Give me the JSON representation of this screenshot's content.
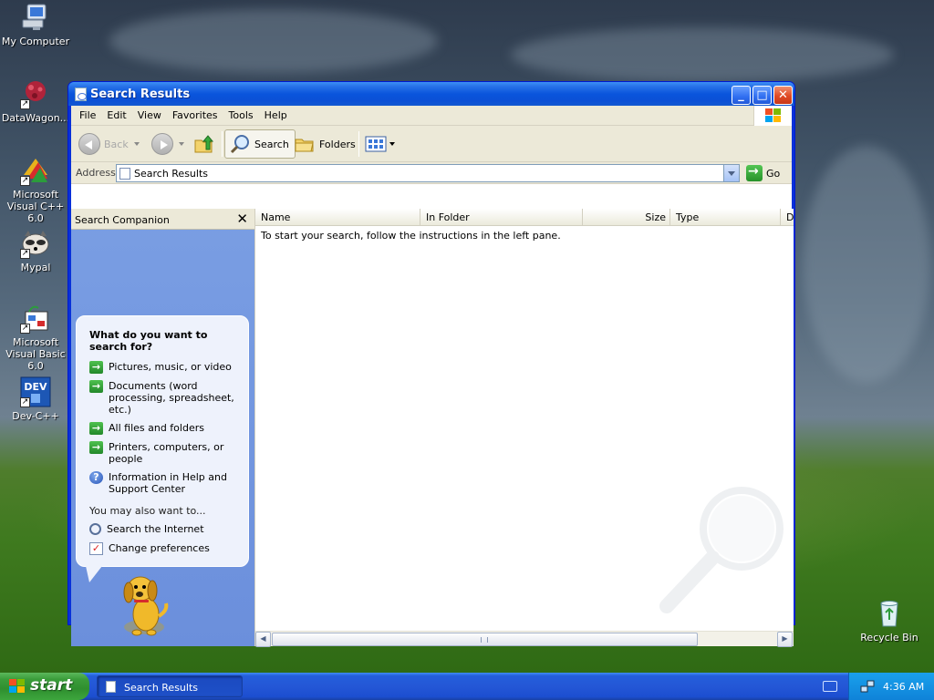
{
  "desktop": {
    "icons": [
      {
        "label": "My Computer"
      },
      {
        "label": "DataWagon..."
      },
      {
        "label": "Microsoft Visual C++ 6.0"
      },
      {
        "label": "Mypal"
      },
      {
        "label": "Microsoft Visual Basic 6.0"
      },
      {
        "label": "Dev-C++"
      },
      {
        "label": "Recycle Bin"
      }
    ]
  },
  "window": {
    "title": "Search Results",
    "controls": {
      "minimize": "_",
      "maximize": "□",
      "close": "✕"
    },
    "menu": [
      "File",
      "Edit",
      "View",
      "Favorites",
      "Tools",
      "Help"
    ],
    "toolbar": {
      "back_label": "Back",
      "search_label": "Search",
      "folders_label": "Folders"
    },
    "address": {
      "label": "Address",
      "value": "Search Results",
      "go_label": "Go"
    },
    "companion": {
      "title": "Search Companion",
      "close_glyph": "✕",
      "question": "What do you want to search for?",
      "options": [
        {
          "label": "Pictures, music, or video",
          "icon": "green-arrow-icon"
        },
        {
          "label": "Documents (word processing, spreadsheet, etc.)",
          "icon": "green-arrow-icon"
        },
        {
          "label": "All files and folders",
          "icon": "green-arrow-icon"
        },
        {
          "label": "Printers, computers, or people",
          "icon": "green-arrow-icon"
        },
        {
          "label": "Information in Help and Support Center",
          "icon": "help-icon"
        }
      ],
      "also_label": "You may also want to...",
      "also_options": [
        {
          "label": "Search the Internet",
          "icon": "search-internet-icon"
        },
        {
          "label": "Change preferences",
          "icon": "preferences-icon"
        }
      ]
    },
    "list": {
      "columns": [
        "Name",
        "In Folder",
        "Size",
        "Type",
        "D"
      ],
      "empty_message": "To start your search, follow the instructions in the left pane."
    }
  },
  "taskbar": {
    "start_label": "start",
    "task_label": "Search Results",
    "clock": "4:36 AM"
  },
  "colors": {
    "titlebar": "#0a55dc",
    "taskbar": "#245edb",
    "start_button": "#3a9c3a",
    "companion_pane": "#7a9ee3"
  }
}
